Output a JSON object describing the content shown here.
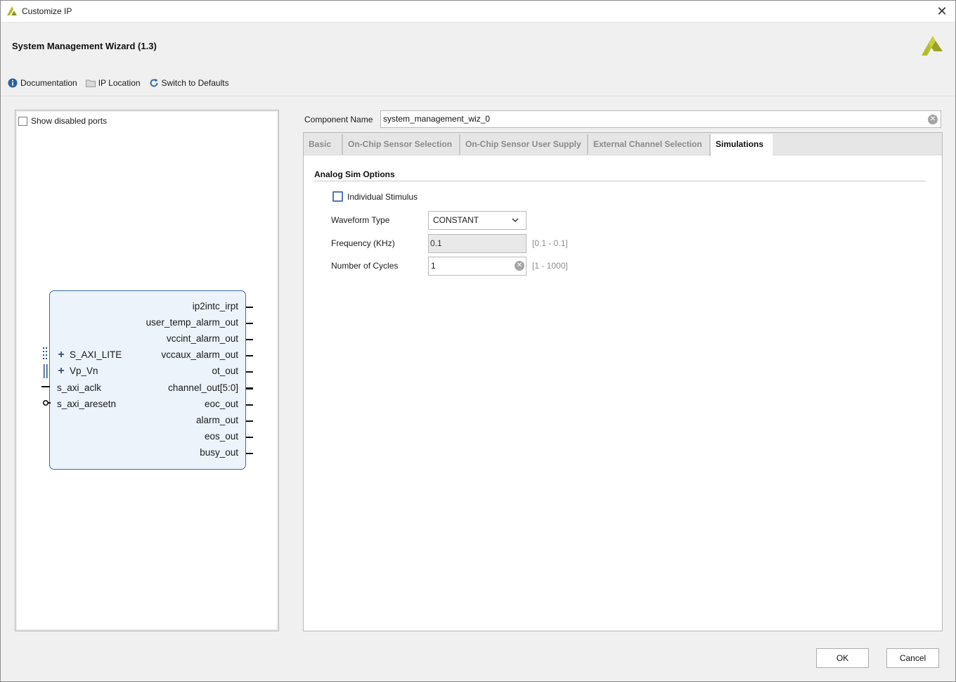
{
  "window": {
    "title": "Customize IP",
    "close_glyph": "✕"
  },
  "header": {
    "wizard_title": "System Management Wizard (1.3)",
    "toolbar": {
      "documentation": "Documentation",
      "ip_location": "IP Location",
      "switch_defaults": "Switch to Defaults"
    }
  },
  "left_panel": {
    "show_disabled_ports": "Show disabled ports",
    "show_disabled_ports_checked": false,
    "block": {
      "left_ports": [
        {
          "label": "S_AXI_LITE",
          "expandable": true
        },
        {
          "label": "Vp_Vn",
          "expandable": true
        },
        {
          "label": "s_axi_aclk",
          "expandable": false
        },
        {
          "label": "s_axi_aresetn",
          "expandable": false
        }
      ],
      "right_ports": [
        "ip2intc_irpt",
        "user_temp_alarm_out",
        "vccint_alarm_out",
        "vccaux_alarm_out",
        "ot_out",
        "channel_out[5:0]",
        "eoc_out",
        "alarm_out",
        "eos_out",
        "busy_out"
      ]
    }
  },
  "component": {
    "label": "Component Name",
    "value": "system_management_wiz_0"
  },
  "tabs": [
    {
      "label": "Basic",
      "active": false
    },
    {
      "label": "On-Chip Sensor Selection",
      "active": false
    },
    {
      "label": "On-Chip Sensor User Supply",
      "active": false
    },
    {
      "label": "External Channel Selection",
      "active": false
    },
    {
      "label": "Simulations",
      "active": true
    }
  ],
  "simulations": {
    "section_title": "Analog Sim Options",
    "individual_stimulus": {
      "label": "Individual Stimulus",
      "checked": false
    },
    "waveform_type": {
      "label": "Waveform Type",
      "value": "CONSTANT"
    },
    "frequency": {
      "label": "Frequency (KHz)",
      "value": "0.1",
      "range": "[0.1 - 0.1]"
    },
    "cycles": {
      "label": "Number of Cycles",
      "value": "1",
      "range": "[1 - 1000]"
    }
  },
  "buttons": {
    "ok": "OK",
    "cancel": "Cancel"
  },
  "colors": {
    "accent": "#3f6aa6",
    "block_fill": "#ecf3fa",
    "logo": "#b5bd2a"
  }
}
